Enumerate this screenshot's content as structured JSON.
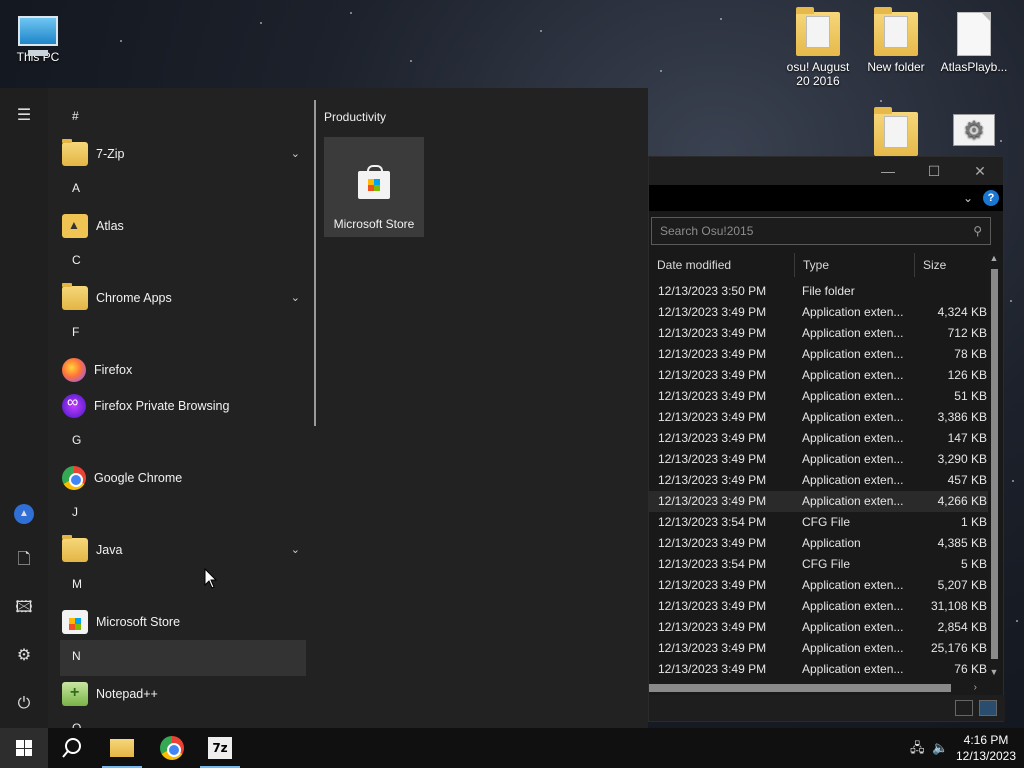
{
  "desktop": {
    "icons": [
      {
        "label": "This PC",
        "kind": "pc"
      },
      {
        "label": "osu! August 20 2016",
        "kind": "folder"
      },
      {
        "label": "New folder",
        "kind": "folder"
      },
      {
        "label": "AtlasPlayb...",
        "kind": "document"
      },
      {
        "label": "",
        "kind": "folder"
      },
      {
        "label": "",
        "kind": "settings-file"
      }
    ]
  },
  "explorer": {
    "search_placeholder": "Search Osu!2015",
    "columns": [
      "Date modified",
      "Type",
      "Size"
    ],
    "rows": [
      {
        "date": "12/13/2023 3:50 PM",
        "type": "File folder",
        "size": ""
      },
      {
        "date": "12/13/2023 3:49 PM",
        "type": "Application exten...",
        "size": "4,324 KB"
      },
      {
        "date": "12/13/2023 3:49 PM",
        "type": "Application exten...",
        "size": "712 KB"
      },
      {
        "date": "12/13/2023 3:49 PM",
        "type": "Application exten...",
        "size": "78 KB"
      },
      {
        "date": "12/13/2023 3:49 PM",
        "type": "Application exten...",
        "size": "126 KB"
      },
      {
        "date": "12/13/2023 3:49 PM",
        "type": "Application exten...",
        "size": "51 KB"
      },
      {
        "date": "12/13/2023 3:49 PM",
        "type": "Application exten...",
        "size": "3,386 KB"
      },
      {
        "date": "12/13/2023 3:49 PM",
        "type": "Application exten...",
        "size": "147 KB"
      },
      {
        "date": "12/13/2023 3:49 PM",
        "type": "Application exten...",
        "size": "3,290 KB"
      },
      {
        "date": "12/13/2023 3:49 PM",
        "type": "Application exten...",
        "size": "457 KB"
      },
      {
        "date": "12/13/2023 3:49 PM",
        "type": "Application exten...",
        "size": "4,266 KB"
      },
      {
        "date": "12/13/2023 3:54 PM",
        "type": "CFG File",
        "size": "1 KB"
      },
      {
        "date": "12/13/2023 3:49 PM",
        "type": "Application",
        "size": "4,385 KB"
      },
      {
        "date": "12/13/2023 3:54 PM",
        "type": "CFG File",
        "size": "5 KB"
      },
      {
        "date": "12/13/2023 3:49 PM",
        "type": "Application exten...",
        "size": "5,207 KB"
      },
      {
        "date": "12/13/2023 3:49 PM",
        "type": "Application exten...",
        "size": "31,108 KB"
      },
      {
        "date": "12/13/2023 3:49 PM",
        "type": "Application exten...",
        "size": "2,854 KB"
      },
      {
        "date": "12/13/2023 3:49 PM",
        "type": "Application exten...",
        "size": "25,176 KB"
      },
      {
        "date": "12/13/2023 3:49 PM",
        "type": "Application exten...",
        "size": "76 KB"
      }
    ],
    "highlighted_row": 10,
    "help_label": "?"
  },
  "start_menu": {
    "sections": [
      {
        "letter": "#",
        "apps": [
          {
            "name": "7-Zip",
            "icon": "folder-icon",
            "expandable": true
          }
        ]
      },
      {
        "letter": "A",
        "apps": [
          {
            "name": "Atlas",
            "icon": "atlas-icon",
            "expandable": false
          }
        ]
      },
      {
        "letter": "C",
        "apps": [
          {
            "name": "Chrome Apps",
            "icon": "folder-icon",
            "expandable": true
          }
        ]
      },
      {
        "letter": "F",
        "apps": [
          {
            "name": "Firefox",
            "icon": "firefox-icon",
            "expandable": false
          },
          {
            "name": "Firefox Private Browsing",
            "icon": "firefox-private-icon",
            "expandable": false
          }
        ]
      },
      {
        "letter": "G",
        "apps": [
          {
            "name": "Google Chrome",
            "icon": "chrome-icon",
            "expandable": false
          }
        ]
      },
      {
        "letter": "J",
        "apps": [
          {
            "name": "Java",
            "icon": "folder-icon",
            "expandable": true
          }
        ]
      },
      {
        "letter": "M",
        "apps": [
          {
            "name": "Microsoft Store",
            "icon": "store-icon",
            "expandable": false
          }
        ]
      },
      {
        "letter": "N",
        "highlighted": true,
        "apps": [
          {
            "name": "Notepad++",
            "icon": "notepadpp-icon",
            "expandable": false
          }
        ]
      },
      {
        "letter": "O",
        "apps": []
      }
    ],
    "tile_group": "Productivity",
    "tile_label": "Microsoft Store",
    "rail": [
      "menu-icon",
      "atlas-icon",
      "document-icon",
      "pictures-icon",
      "settings-icon",
      "power-icon"
    ]
  },
  "taskbar": {
    "time": "4:16 PM",
    "date": "12/13/2023",
    "seven_zip_label": "7z"
  }
}
